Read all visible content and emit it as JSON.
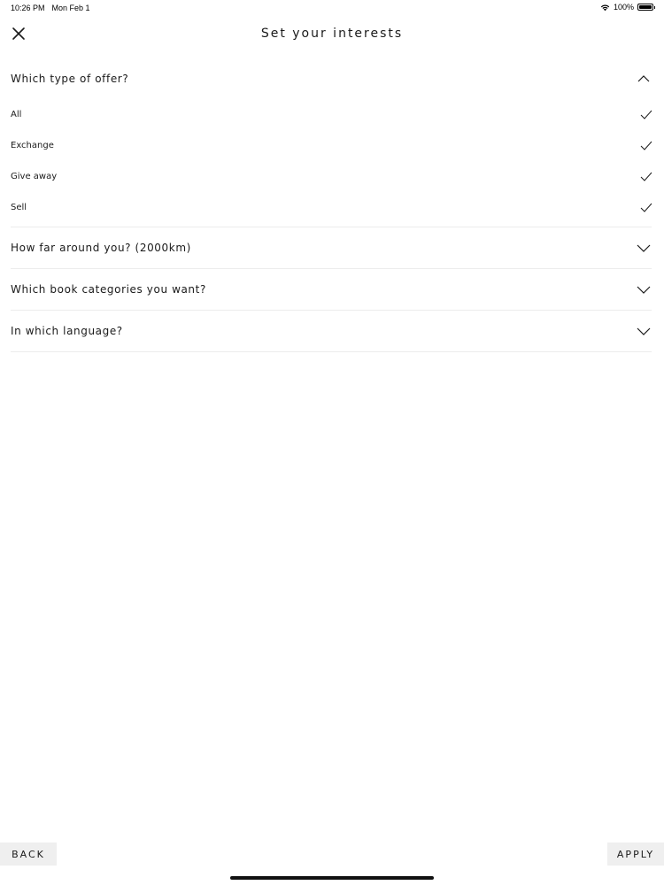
{
  "status_bar": {
    "time": "10:26 PM",
    "date": "Mon Feb 1",
    "battery": "100%",
    "wifi_icon": "wifi-icon",
    "battery_icon": "battery-icon"
  },
  "header": {
    "title": "Set your interests",
    "close_icon": "close-icon"
  },
  "sections": [
    {
      "title": "Which type of offer?",
      "expanded": true,
      "options": [
        {
          "label": "All",
          "checked": true
        },
        {
          "label": "Exchange",
          "checked": true
        },
        {
          "label": "Give away",
          "checked": true
        },
        {
          "label": "Sell",
          "checked": true
        }
      ]
    },
    {
      "title": "How far around you? (2000km)",
      "expanded": false
    },
    {
      "title": "Which book categories you want?",
      "expanded": false
    },
    {
      "title": "In which language?",
      "expanded": false
    }
  ],
  "footer": {
    "back_label": "BACK",
    "apply_label": "APPLY"
  }
}
